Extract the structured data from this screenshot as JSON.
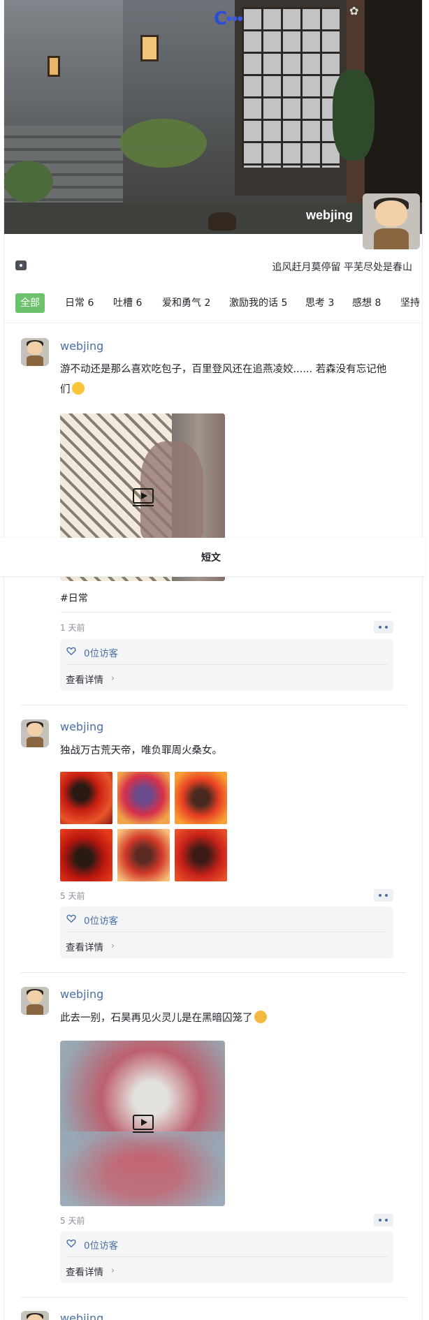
{
  "header": {
    "username": "webjing",
    "signature": "追风赶月莫停留 平芜尽处是春山"
  },
  "tabs": [
    {
      "label": "全部",
      "active": true
    },
    {
      "label": "日常 6"
    },
    {
      "label": "吐槽 6"
    },
    {
      "label": "爱和勇气 2"
    },
    {
      "label": "激励我的话 5"
    },
    {
      "label": "思考 3"
    },
    {
      "label": "感想 8"
    },
    {
      "label": "坚持"
    }
  ],
  "sticky_title": "短文",
  "posts": [
    {
      "author": "webjing",
      "text": "游不动还是那么喜欢吃包子，百里登风还在追燕凌姣...... 若森没有忘记他们",
      "media": "video",
      "topic": "#日常",
      "time": "1 天前",
      "visitors": "0位访客",
      "details": "查看详情"
    },
    {
      "author": "webjing",
      "text": "独战万古荒天帝，唯负罪周火桑女。",
      "media": "images",
      "image_count": 6,
      "time": "5 天前",
      "visitors": "0位访客",
      "details": "查看详情"
    },
    {
      "author": "webjing",
      "text": "此去一别，石昊再见火灵儿是在黑暗囚笼了",
      "media": "video",
      "time": "5 天前",
      "visitors": "0位访客",
      "details": "查看详情"
    },
    {
      "author": "webjing"
    }
  ],
  "colors": {
    "accent_green": "#6cc26b",
    "link_blue": "#4a6fa5"
  }
}
